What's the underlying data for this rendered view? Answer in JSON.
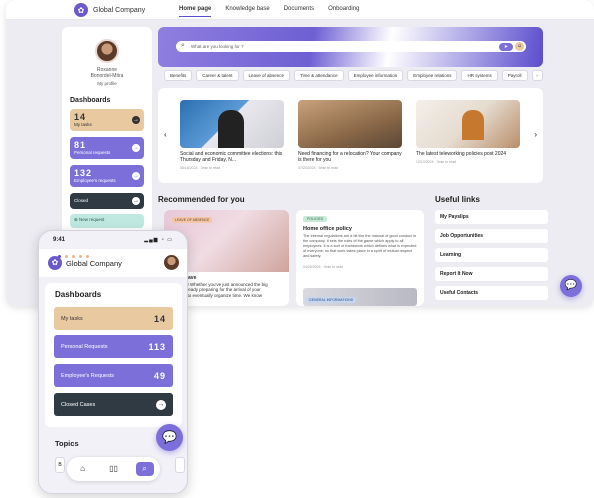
{
  "desktop": {
    "brand": "Global Company",
    "nav": [
      "Home page",
      "Knowledge base",
      "Documents",
      "Onboarding"
    ],
    "profile": {
      "name_line1": "Roxanne",
      "name_line2": "Bonordel-Mitra",
      "link": "My profile"
    },
    "dashboards": {
      "title": "Dashboards",
      "tasks": {
        "num": "14",
        "label": "My tasks"
      },
      "personal": {
        "num": "81",
        "label": "Personal requests"
      },
      "employee": {
        "num": "132",
        "label": "Employee's requests"
      },
      "closed": "Closed",
      "new_request": "New request"
    },
    "search": {
      "placeholder": "What are you looking for ?"
    },
    "chips": [
      "Benefits",
      "Career & talent",
      "Leave of absence",
      "Time & attendance",
      "Employee information",
      "Employee relations",
      "HR systems",
      "Payroll"
    ],
    "articles": [
      {
        "title": "Social and economic committee elections: this Thursday and Friday, N...",
        "meta": "08/16/2024 · 3min to read"
      },
      {
        "title": "Need financing for a relocation? Your company is there for you",
        "meta": "07/20/2024 · 5min to read"
      },
      {
        "title": "The latest teleworking policies post 2024",
        "meta": "12/13/2024 · 3min to read"
      }
    ],
    "recommended": {
      "title": "Recommended for you",
      "card1": {
        "tag": "LEAVE OF ABSENCE",
        "line1": "y Leave",
        "line2": "ious ! Whether you've just announced the big",
        "line3": "re already preparing for the arrival of your",
        "line4": "how to eventually organize time. We know"
      },
      "card2": {
        "tag": "POLICIES",
        "title": "Home office policy",
        "body": "The internal regulations are a bit like the manual of good conduct in the company. It sets the rules of the game which apply to all employees. It is a sort of framework which defines what is expected of everyone, so that work takes place in a spirit of mutual respect and safety.",
        "meta": "04/25/2024 · 3min to read",
        "tag2": "GENERAL INFORMATIONS"
      }
    },
    "useful_links": {
      "title": "Useful links",
      "items": [
        "My Payslips",
        "Job Opportunities",
        "Learning",
        "Report It Now",
        "Useful Contacts"
      ]
    }
  },
  "mobile": {
    "time": "9:41",
    "brand": "Global Company",
    "dashboards_title": "Dashboards",
    "cards": [
      {
        "label": "My tasks",
        "num": "14"
      },
      {
        "label": "Personal Requests",
        "num": "113"
      },
      {
        "label": "Employee's Requests",
        "num": "49"
      },
      {
        "label": "Closed Cases",
        "num": ""
      }
    ],
    "topics_title": "Topics",
    "chip_partial": "B"
  }
}
